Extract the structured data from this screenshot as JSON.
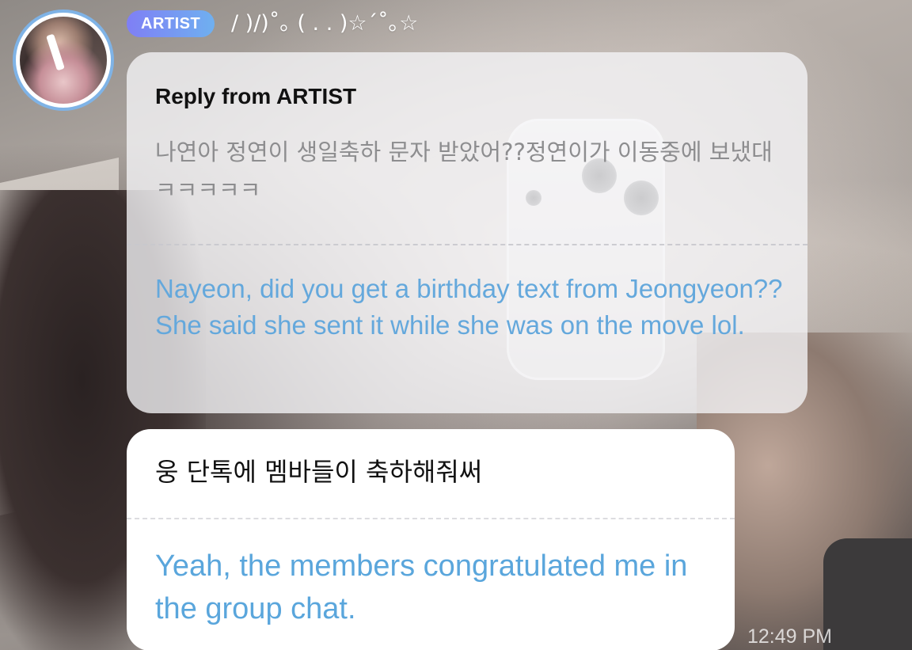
{
  "header": {
    "badge_label": "ARTIST",
    "artist_name": "/ )/)˚｡ ( . . )☆´˚｡☆"
  },
  "reply": {
    "title": "Reply from ARTIST",
    "original_text": "나연아 정연이 생일축하 문자 받았어??정연이가 이동중에 보냈대ㅋㅋㅋㅋㅋ",
    "translation": "Nayeon, did you get a birthday text from Jeongyeon?? She said she sent it while she was on the move lol."
  },
  "message": {
    "original_text": "웅 단톡에 멤바들이 축하해줘써",
    "translation": "Yeah, the members congratulated me in the group chat.",
    "timestamp": "12:49 PM"
  },
  "colors": {
    "badge_gradient_start": "#7f7ff5",
    "badge_gradient_end": "#6fb0f0",
    "translation_text": "#5aa6dc",
    "avatar_ring": "#7fb3e6"
  }
}
